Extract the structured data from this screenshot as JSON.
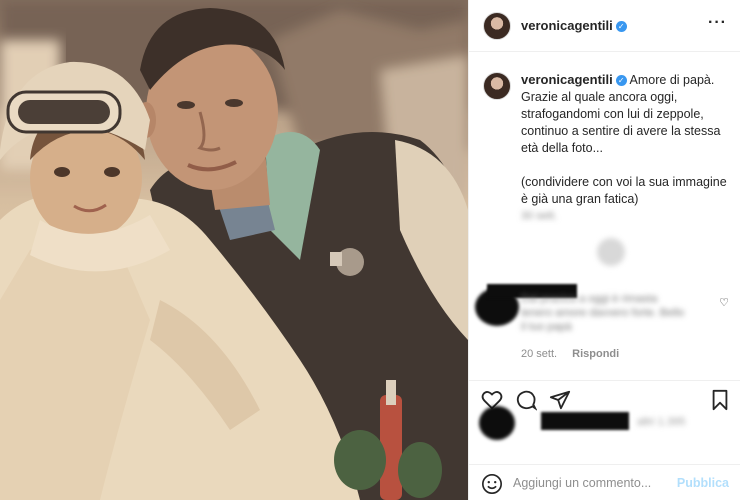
{
  "post": {
    "username": "veronicagentili",
    "verified_badge": "verified-check-icon",
    "more_icon": "more-options-icon",
    "caption": {
      "username": "veronicagentili",
      "paragraph1": "Amore di papà.\nGrazie al quale ancora oggi, strafogandomi con lui di zeppole, continuo a sentire di avere la stessa età della foto...",
      "paragraph2": "(condividere con voi la sua immagine è già una gran fatica)",
      "time": "30 sett."
    },
    "comment": {
      "text": "Dal pracica a oggi è rimasta tenero amore davvero forte. Bello il tuo papà",
      "time": "20 sett.",
      "reply_label": "Rispondi"
    },
    "likes": {
      "text": "altri 1.395"
    },
    "add_comment": {
      "placeholder": "Aggiungi un commento...",
      "publish_label": "Pubblica"
    },
    "icons": {
      "like": "heart-icon",
      "comment": "comment-bubble-icon",
      "share": "paper-plane-icon",
      "save": "bookmark-icon",
      "emoji": "emoji-smile-icon"
    },
    "colors": {
      "accent_blue": "#3897f0",
      "publish_disabled": "#b2dffc",
      "text": "#262626",
      "muted": "#8e8e8e"
    }
  }
}
